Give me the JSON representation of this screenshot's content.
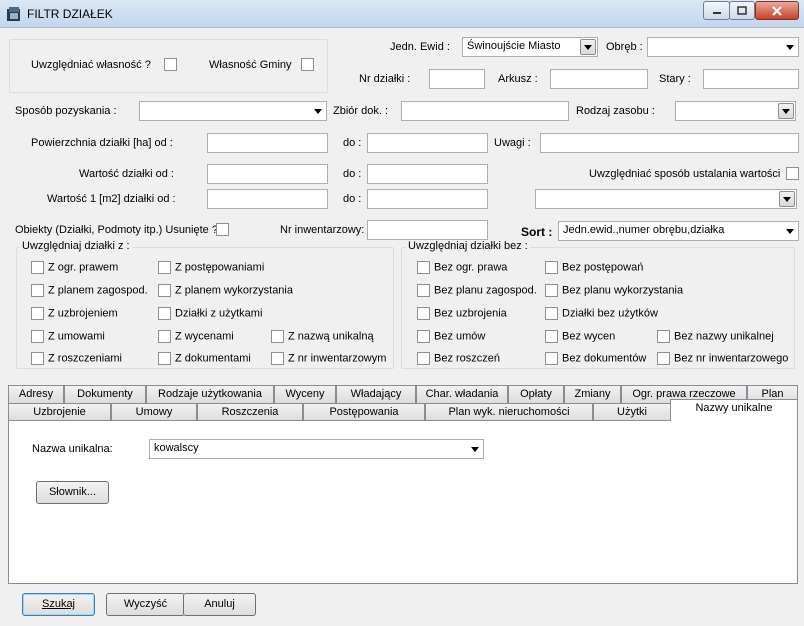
{
  "window": {
    "title": "FILTR DZIAŁEK",
    "minimize_icon": "minimize-icon",
    "maximize_icon": "maximize-icon",
    "close_icon": "close-icon"
  },
  "top": {
    "own_label": "Uwzględniać własność ?",
    "gmina_label": "Własność Gminy",
    "jedn_label": "Jedn. Ewid :",
    "jedn_value": "Świnoujście Miasto",
    "obreb_label": "Obręb :",
    "obreb_value": "",
    "nr_label": "Nr działki :",
    "nr_value": "",
    "arkusz_label": "Arkusz :",
    "arkusz_value": "",
    "stary_label": "Stary :",
    "stary_value": "",
    "sposob_label": "Sposób pozyskania :",
    "sposob_value": "",
    "zbior_label": "Zbiór dok. :",
    "zbior_value": "",
    "rodzaj_label": "Rodzaj zasobu :",
    "rodzaj_value": "",
    "pow_label": "Powierzchnia działki [ha]  od :",
    "do_label": "do :",
    "uwagi_label": "Uwagi :",
    "wart_label": "Wartość działki od :",
    "sposob_ust_label": "Uwzględniać sposób ustalania wartości",
    "wart1_label": "Wartość 1 [m2] działki od :",
    "obiekty_label": "Obiekty (Działki, Podmoty itp.) Usunięte ?",
    "nrinw_label": "Nr inwentarzowy:",
    "sort_label": "Sort :",
    "sort_value": "Jedn.ewid.,numer obrębu,działka"
  },
  "group_z": {
    "title": "Uwzględniaj działki z :",
    "items": [
      "Z ogr. prawem",
      "Z postępowaniami",
      "Z planem zagospod.",
      "Z planem wykorzystania",
      "Z uzbrojeniem",
      "Działki z użytkami",
      "Z umowami",
      "Z wycenami",
      "Z nazwą unikalną",
      "Z roszczeniami",
      "Z dokumentami",
      "Z nr inwentarzowym"
    ]
  },
  "group_bez": {
    "title": "Uwzględniaj działki bez :",
    "items": [
      "Bez ogr. prawa",
      "Bez postępowań",
      "Bez planu zagospod.",
      "Bez planu wykorzystania",
      "Bez uzbrojenia",
      "Działki bez użytków",
      "Bez umów",
      "Bez wycen",
      "Bez nazwy unikalnej",
      "Bez roszczeń",
      "Bez dokumentów",
      "Bez nr inwentarzowego"
    ]
  },
  "tabs_row1": [
    "Adresy",
    "Dokumenty",
    "Rodzaje użytkowania",
    "Wyceny",
    "Władający",
    "Char. władania",
    "Opłaty",
    "Zmiany",
    "Ogr. prawa rzeczowe",
    "Plan"
  ],
  "tabs_row2": [
    "Uzbrojenie",
    "Umowy",
    "Roszczenia",
    "Postępowania",
    "Plan wyk. nieruchomości",
    "Użytki",
    "Nazwy unikalne"
  ],
  "panel": {
    "nazwa_label": "Nazwa unikalna:",
    "nazwa_value": "kowalscy",
    "slownik_label": "Słownik..."
  },
  "buttons": {
    "szukaj": "Szukaj",
    "wyczysc": "Wyczyść",
    "anuluj": "Anuluj"
  }
}
